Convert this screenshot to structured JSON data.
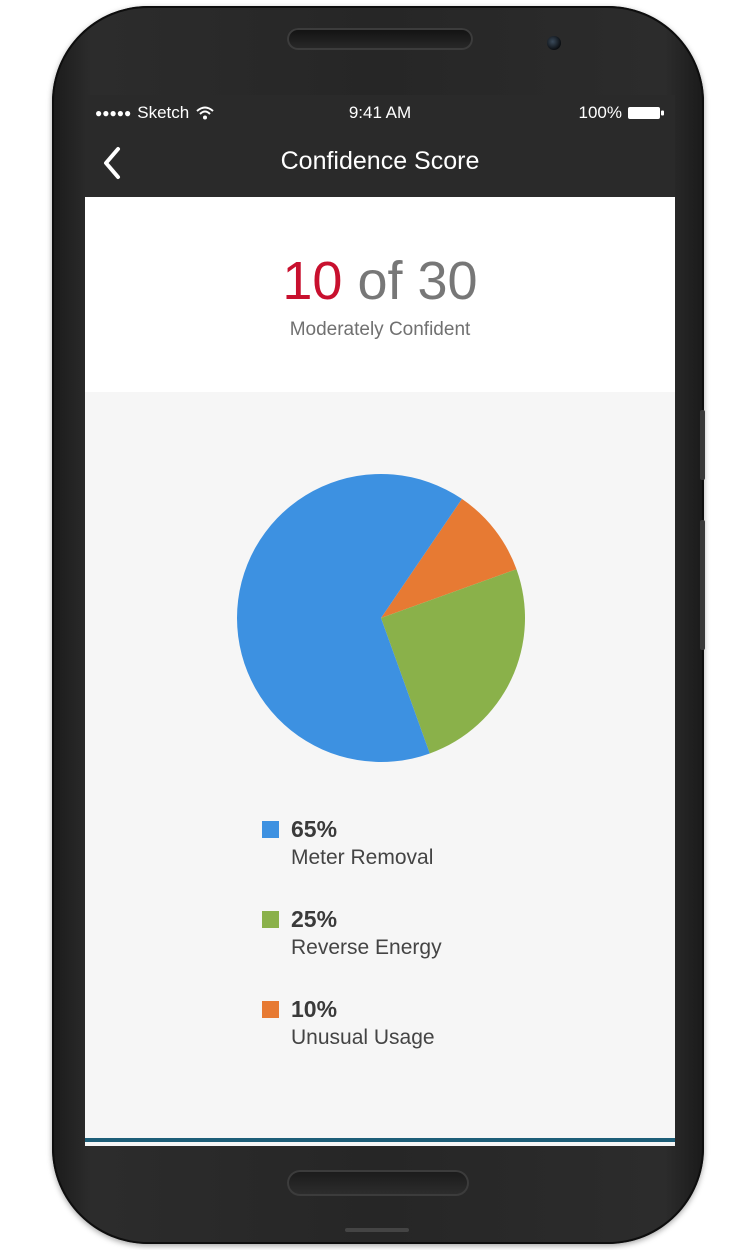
{
  "status_bar": {
    "carrier": "Sketch",
    "time": "9:41 AM",
    "battery": "100%",
    "signal_dots": "●●●●●"
  },
  "nav": {
    "title": "Confidence Score",
    "back_icon": "chevron-left-icon"
  },
  "score": {
    "value": "10",
    "separator": " of ",
    "total": "30",
    "description": "Moderately Confident",
    "value_color": "#c8102e"
  },
  "chart_data": {
    "type": "pie",
    "slices": [
      {
        "percent_label": "65%",
        "label": "Meter Removal",
        "value": 65,
        "color": "#3d91e1"
      },
      {
        "percent_label": "25%",
        "label": "Reverse Energy",
        "value": 25,
        "color": "#8ab14a"
      },
      {
        "percent_label": "10%",
        "label": "Unusual Usage",
        "value": 10,
        "color": "#e77a33"
      }
    ],
    "legend_position": "bottom"
  }
}
